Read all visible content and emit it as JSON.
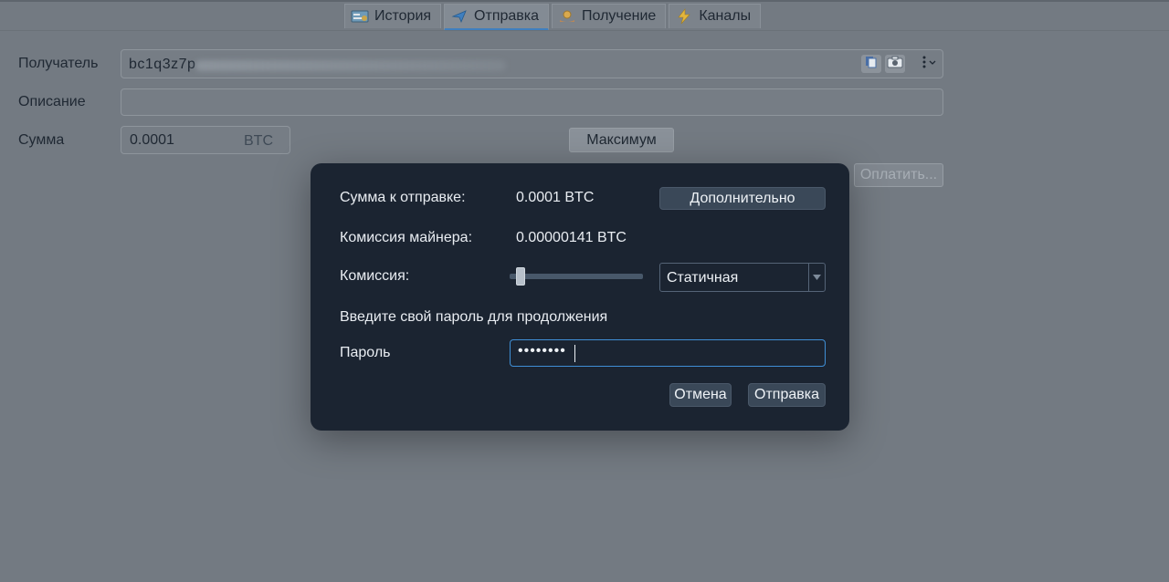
{
  "tabs": [
    {
      "label": "История",
      "icon": "history-icon",
      "active": false
    },
    {
      "label": "Отправка",
      "icon": "send-icon",
      "active": true
    },
    {
      "label": "Получение",
      "icon": "receive-icon",
      "active": false
    },
    {
      "label": "Каналы",
      "icon": "lightning-icon",
      "active": false
    }
  ],
  "form": {
    "recipient_label": "Получатель",
    "recipient_value": "bc1q3z7p",
    "description_label": "Описание",
    "description_value": "",
    "amount_label": "Сумма",
    "amount_value": "0.0001",
    "amount_unit": "BTC",
    "max_button": "Максимум",
    "pay_button": "Оплатить..."
  },
  "dialog": {
    "amount_label": "Сумма к отправке:",
    "amount_value": "0.0001 BTC",
    "advanced_button": "Дополнительно",
    "miner_fee_label": "Комиссия майнера:",
    "miner_fee_value": "0.00000141 BTC",
    "fee_label": "Комиссия:",
    "fee_mode": "Статичная",
    "fee_slider_level": 0.05,
    "prompt": "Введите свой пароль для продолжения",
    "password_label": "Пароль",
    "password_value": "••••••••",
    "cancel_button": "Отмена",
    "send_button": "Отправка"
  },
  "colors": {
    "dialog_bg": "#1b2431",
    "accent": "#3f8fd6",
    "background": "#737a82"
  }
}
